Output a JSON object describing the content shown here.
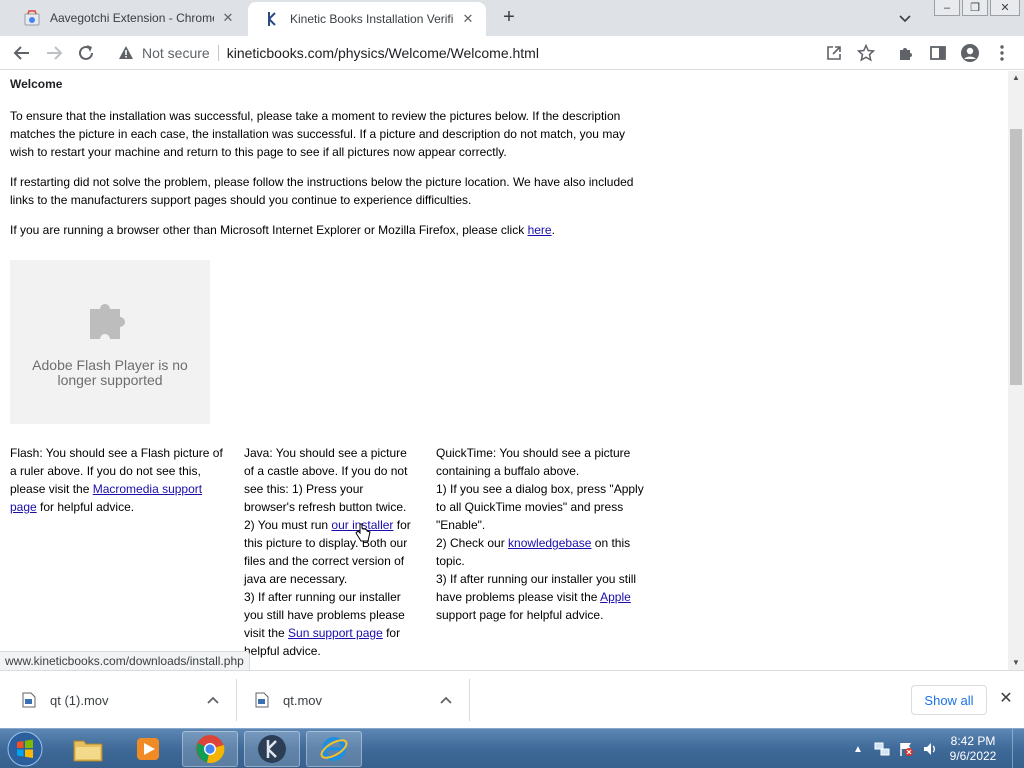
{
  "browser": {
    "tabs": [
      {
        "title": "Aavegotchi Extension - Chrome W",
        "active": false
      },
      {
        "title": "Kinetic Books Installation Verifica",
        "active": true
      }
    ],
    "address": {
      "security_label": "Not secure",
      "url": "kineticbooks.com/physics/Welcome/Welcome.html"
    }
  },
  "page": {
    "heading": "Welcome",
    "para1": "To ensure that the installation was successful, please take a moment to review the pictures below. If the description matches the picture in each case, the installation was successful. If a picture and description do not match, you may wish to restart your machine and return to this page to see if all pictures now appear correctly.",
    "para2": "If restarting did not solve the problem, please follow the instructions below the picture location. We have also included links to the manufacturers support pages should you continue to experience difficulties.",
    "para3_prefix": "If you are running a browser other than Microsoft Internet Explorer or Mozilla Firefox, please click ",
    "para3_link": "here",
    "para3_suffix": ".",
    "plugin_message": "Adobe Flash Player is no longer supported",
    "flash": {
      "text1": "Flash: You should see a Flash picture of a ruler above. If you do not see this, please visit the ",
      "link": "Macromedia support page",
      "text2": " for helpful advice."
    },
    "java": {
      "text1": "Java: You should see a picture of a castle above. If you do not see this: 1) Press your browser's refresh button twice.",
      "text2": "2) You must run ",
      "link1": "our installer",
      "text3": " for this picture to display. Both our files and the correct version of java are necessary.",
      "text4": "3) If after running our installer you still have problems please visit the ",
      "link2": "Sun support page",
      "text5": " for helpful advice."
    },
    "quicktime": {
      "text1": "QuickTime: You should see a picture containing a buffalo above.",
      "text2": "1) If you see a dialog box, press \"Apply to all QuickTime movies\" and press \"Enable\".",
      "text3": "2) Check our ",
      "link1": "knowledgebase",
      "text4": " on this topic.",
      "text5": "3) If after running our installer you still have problems please visit the ",
      "link2": "Apple",
      "text6": " support page for helpful advice."
    }
  },
  "status_bar_url": "www.kineticbooks.com/downloads/install.php",
  "downloads": {
    "items": [
      {
        "name": "qt (1).mov"
      },
      {
        "name": "qt.mov"
      }
    ],
    "show_all_label": "Show all"
  },
  "taskbar": {
    "time": "8:42 PM",
    "date": "9/6/2022"
  },
  "colors": {
    "link": "#1a0dab",
    "tab_strip": "#dee1e6",
    "taskbar": "#3f6a99"
  }
}
